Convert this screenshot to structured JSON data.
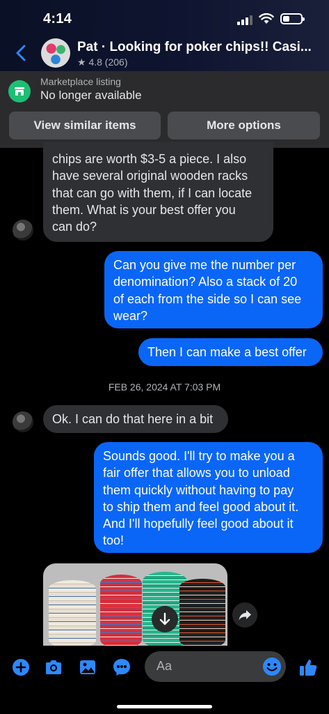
{
  "status_bar": {
    "time": "4:14"
  },
  "header": {
    "title": "Pat · Looking for poker chips!! Casi...",
    "rating": "★ 4.8 (206)"
  },
  "listing": {
    "label": "Marketplace listing",
    "status": "No longer available",
    "view_similar": "View similar items",
    "more_options": "More options"
  },
  "messages": [
    {
      "from": "them",
      "text": "chips are worth $3-5 a piece. I also\nhave several original wooden racks\nthat can go with them, if I can locate\nthem.  What is your best offer you\ncan do?"
    },
    {
      "from": "me",
      "text": "Can you give me the number per\ndenomination?  Also a stack of 20\nof each from the side so I can see\nwear?"
    },
    {
      "from": "me",
      "text": "Then I can make a best offer"
    },
    {
      "from": "them",
      "text": "Ok. I can do that here in a bit"
    },
    {
      "from": "me",
      "text": "Sounds good. I'll try to make you a\nfair offer that allows you to unload\nthem quickly without having to pay\nto ship them and feel good about it.\nAnd I'll hopefully feel good about it\ntoo!"
    }
  ],
  "timestamp": "FEB 26, 2024 AT 7:03 PM",
  "composer": {
    "placeholder": "Aa"
  },
  "colors": {
    "accent": "#0a66f7",
    "incoming": "#2f3033",
    "marketplace": "#1dbf73"
  },
  "icons": [
    "back-icon",
    "marketplace-icon",
    "plus-icon",
    "camera-icon",
    "gallery-icon",
    "voice-icon",
    "emoji-icon",
    "like-icon",
    "download-icon",
    "share-icon"
  ]
}
